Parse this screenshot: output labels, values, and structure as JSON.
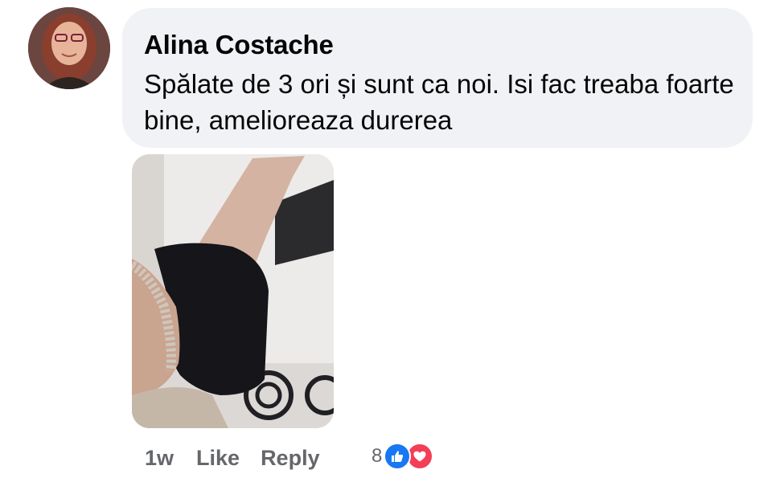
{
  "comment": {
    "author": "Alina Costache",
    "text": "Spălate de 3 ori și sunt ca noi. Isi fac treaba foarte bine, amelioreaza durerea",
    "timestamp": "1w",
    "like_label": "Like",
    "reply_label": "Reply",
    "reaction_count": "8",
    "reactions": [
      "like-icon",
      "love-icon"
    ]
  },
  "colors": {
    "bubble": "#f0f2f5",
    "secondary_text": "#65676b",
    "like": "#1877f2",
    "love": "#f33e58"
  }
}
